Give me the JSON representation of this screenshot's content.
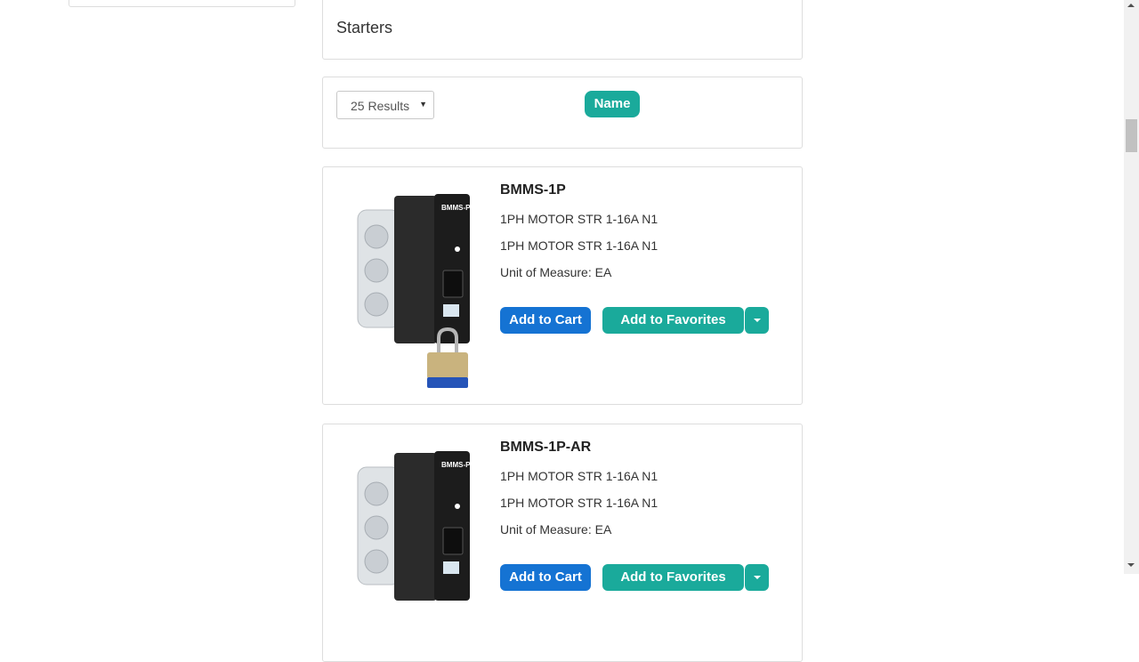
{
  "category": {
    "title": "Starters"
  },
  "sort": {
    "results_per_page": "25 Results",
    "sort_by": "Name"
  },
  "colors": {
    "primary": "#1573d3",
    "teal": "#1aaa9b"
  },
  "products": [
    {
      "name": "BMMS-1P",
      "description_1": "1PH MOTOR STR 1-16A N1",
      "description_2": "1PH MOTOR STR 1-16A N1",
      "unit_of_measure": "Unit of Measure: EA",
      "add_to_cart": "Add to Cart",
      "add_to_favorites": "Add to Favorites",
      "device_label": "BMMS-P"
    },
    {
      "name": "BMMS-1P-AR",
      "description_1": "1PH MOTOR STR 1-16A N1",
      "description_2": "1PH MOTOR STR 1-16A N1",
      "unit_of_measure": "Unit of Measure: EA",
      "add_to_cart": "Add to Cart",
      "add_to_favorites": "Add to Favorites",
      "device_label": "BMMS-P"
    }
  ]
}
